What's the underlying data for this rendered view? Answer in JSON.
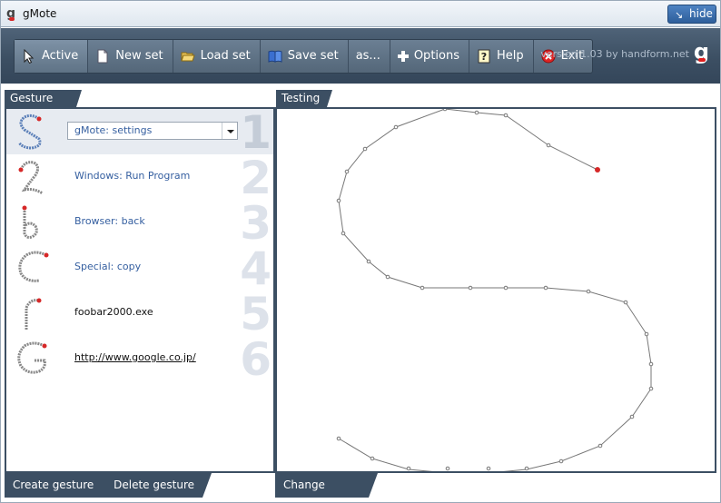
{
  "window": {
    "title": "gMote",
    "hide_label": "hide"
  },
  "toolbar": {
    "buttons": [
      {
        "label": "Active",
        "icon": "cursor-icon"
      },
      {
        "label": "New set",
        "icon": "new-document-icon"
      },
      {
        "label": "Load set",
        "icon": "open-folder-icon"
      },
      {
        "label": "Save set",
        "icon": "book-icon"
      },
      {
        "label": "as...",
        "icon": ""
      },
      {
        "label": "Options",
        "icon": "plus-icon"
      },
      {
        "label": "Help",
        "icon": "help-icon"
      },
      {
        "label": "Exit",
        "icon": "exit-icon"
      }
    ],
    "version": "version 1.03 by handform.net",
    "logo": "g"
  },
  "gesture_panel": {
    "tab": "Gesture set",
    "gestures": [
      {
        "label": "gMote: settings",
        "number": "1",
        "shape": "S"
      },
      {
        "label": "Windows: Run Program",
        "number": "2",
        "shape": "2"
      },
      {
        "label": "Browser: back",
        "number": "3",
        "shape": "b"
      },
      {
        "label": "Special: copy",
        "number": "4",
        "shape": "C"
      },
      {
        "label": "foobar2000.exe",
        "number": "5",
        "shape": "r"
      },
      {
        "label": "http://www.google.co.jp/",
        "number": "6",
        "shape": "G"
      }
    ],
    "create_label": "Create gesture",
    "delete_label": "Delete gesture"
  },
  "testing_panel": {
    "tab": "Testing",
    "change_motion_label": "Change motion"
  },
  "colors": {
    "dark_panel": "#3c4f63",
    "accent_red": "#d62828",
    "link_blue": "#355fa0",
    "title_bar": "#dfe7ef"
  }
}
